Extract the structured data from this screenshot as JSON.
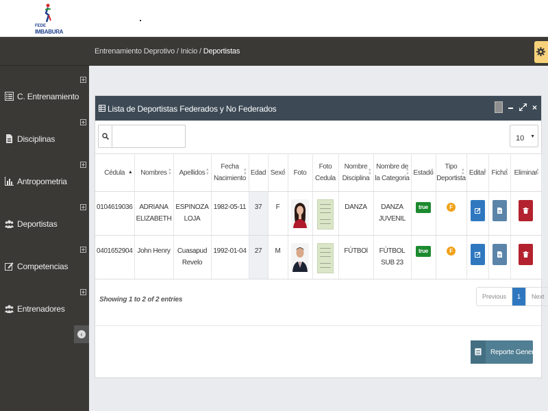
{
  "logo": {
    "line1": "FEDE",
    "line2": "IMBABURA"
  },
  "breadcrumb": {
    "path": "Entrenamiento Deprotivo / Inicio /",
    "current": "Deportistas"
  },
  "sidebar": {
    "items": [
      {
        "label": "C. Entrenamiento",
        "icon": "list-icon"
      },
      {
        "label": "Disciplinas",
        "icon": "document-icon"
      },
      {
        "label": "Antropometria",
        "icon": "bar-chart-icon"
      },
      {
        "label": "Deportistas",
        "icon": "users-icon"
      },
      {
        "label": "Competencias",
        "icon": "edit-icon"
      },
      {
        "label": "Entrenadores",
        "icon": "users-icon"
      }
    ]
  },
  "panel": {
    "title": "Lista de Deportistas Federados y No Federados"
  },
  "search": {
    "placeholder": "",
    "value": ""
  },
  "page_length": {
    "value": "10"
  },
  "table": {
    "headers": [
      [
        "Cédula"
      ],
      [
        "Nombres"
      ],
      [
        "Apellidos"
      ],
      [
        "Fecha",
        "Nacimiento"
      ],
      [
        "Edad"
      ],
      [
        "Sexo"
      ],
      [
        "Foto"
      ],
      [
        "Foto",
        "Cedula"
      ],
      [
        "Nombre",
        "Disciplina"
      ],
      [
        "Nombre de",
        "la Categoria"
      ],
      [
        "Estado"
      ],
      [
        "Tipo",
        "Deportista"
      ],
      [
        "Editar"
      ],
      [
        "Ficha"
      ],
      [
        "Eliminar"
      ]
    ],
    "rows": [
      {
        "cedula": "0104619036",
        "nombres": [
          "ADRIANA",
          "ELIZABETH"
        ],
        "apellidos": [
          "ESPINOZA",
          "LOJA"
        ],
        "fecha": "1982-05-11",
        "edad": "37",
        "sexo": "F",
        "disciplina": "DANZA",
        "categoria": [
          "DANZA",
          "JUVENIL"
        ],
        "estado": "true",
        "tipo": "F"
      },
      {
        "cedula": "0401652904",
        "nombres": [
          "John Henry"
        ],
        "apellidos": [
          "Cuasapud",
          "Revelo"
        ],
        "fecha": "1992-01-04",
        "edad": "27",
        "sexo": "M",
        "disciplina": "FÚTBOl",
        "categoria": [
          "FÚTBOL",
          "SUB 23"
        ],
        "estado": "true",
        "tipo": "F"
      }
    ]
  },
  "info": "Showing 1 to 2 of 2 entries",
  "pager": {
    "prev": "Previous",
    "page": "1",
    "next": "Next"
  },
  "report_button": {
    "label": "Reporte General"
  },
  "colors": {
    "sidebar": "#3a3936",
    "panel_header": "#3d4a56",
    "primary": "#2f78c0",
    "danger": "#b3222e",
    "success": "#1c8a2f",
    "warning": "#f0a21b"
  }
}
